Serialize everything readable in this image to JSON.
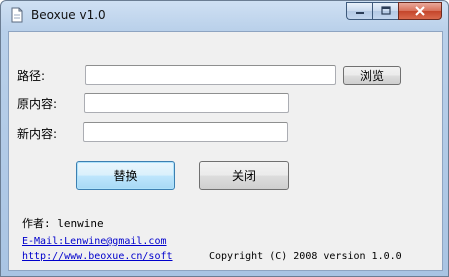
{
  "window": {
    "title": "Beoxue v1.0",
    "minimize_glyph": "–",
    "maximize_glyph": "□",
    "close_glyph": "✕"
  },
  "form": {
    "path_label": "路径:",
    "path_value": "",
    "browse_label": "浏览",
    "original_label": "原内容:",
    "original_value": "",
    "new_label": "新内容:",
    "new_value": ""
  },
  "actions": {
    "replace_label": "替换",
    "close_label": "关闭"
  },
  "footer": {
    "author": "作者: lenwine",
    "email": "E-Mail:Lenwine@gmail.com",
    "website": "http://www.beoxue.cn/soft",
    "copyright": "Copyright (C) 2008 version 1.0.0"
  }
}
